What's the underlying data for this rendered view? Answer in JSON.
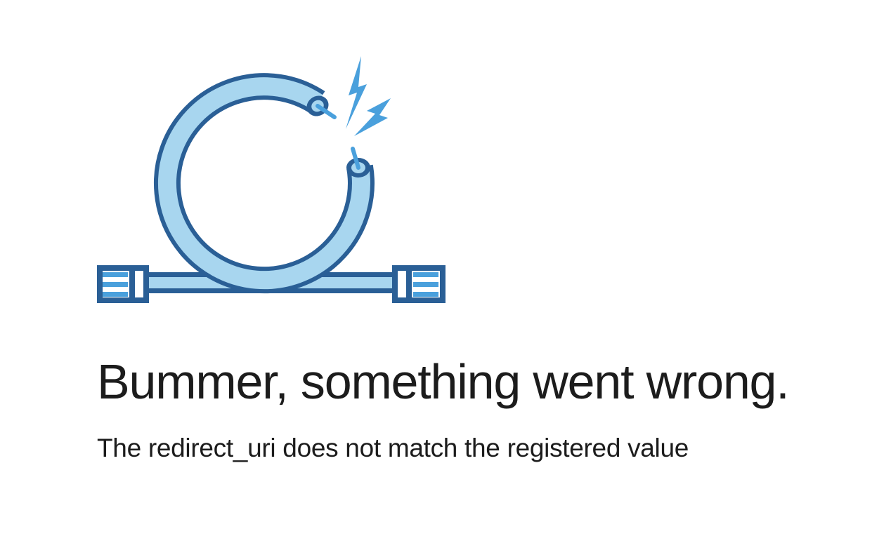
{
  "error": {
    "title": "Bummer, something went wrong.",
    "message": "The redirect_uri does not match the registered value"
  },
  "illustration": {
    "icon": "broken-cable-icon",
    "outline_color": "#2a5f96",
    "fill_color": "#a8d6ef",
    "spark_color": "#4aa0dc"
  }
}
